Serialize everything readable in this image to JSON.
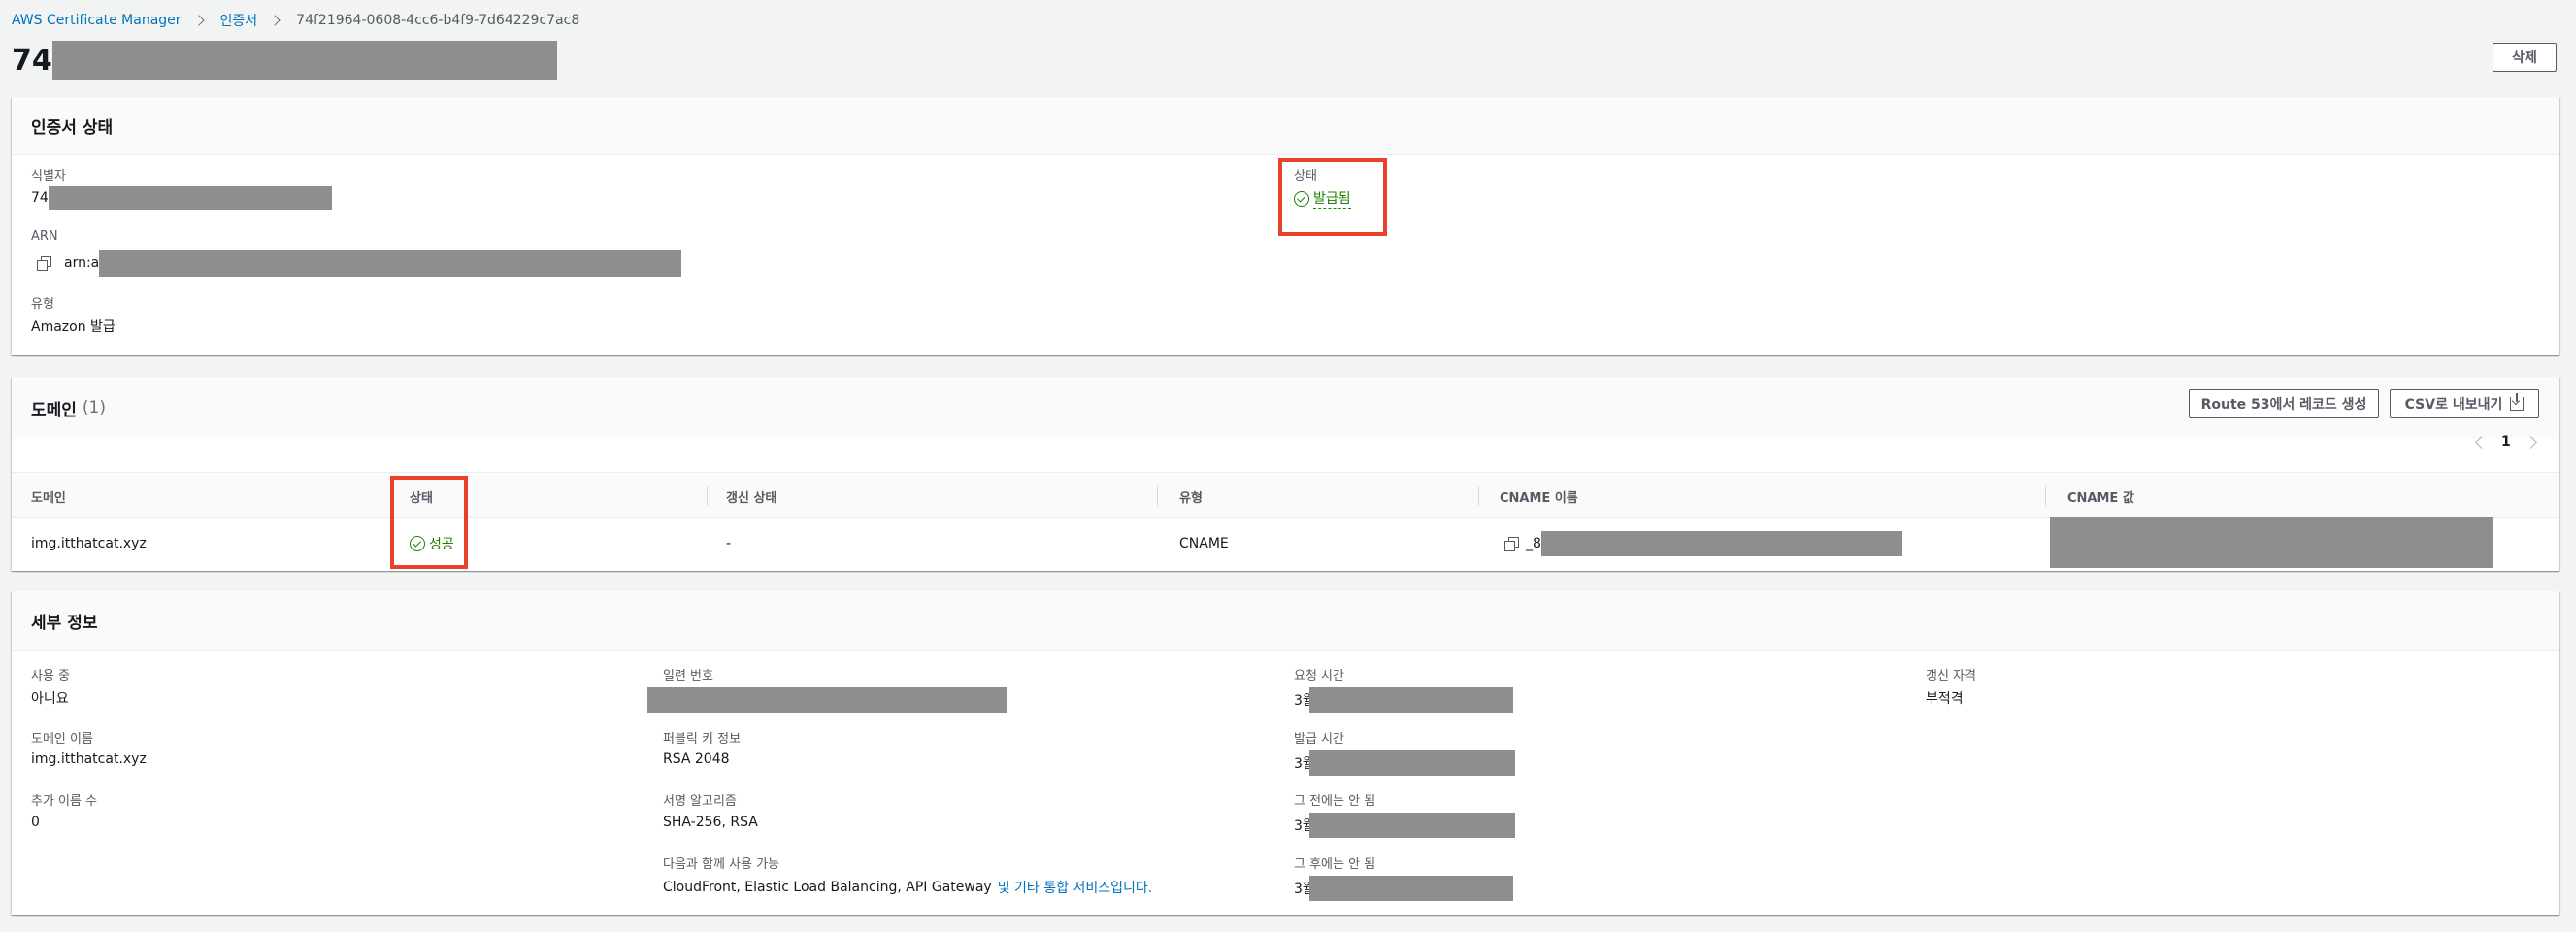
{
  "breadcrumb": {
    "items": [
      "AWS Certificate Manager",
      "인증서",
      "74f21964-0608-4cc6-b4f9-7d64229c7ac8"
    ]
  },
  "header": {
    "title_prefix": "74",
    "delete_label": "삭제"
  },
  "cert_status": {
    "title": "인증서 상태",
    "identifier_label": "식별자",
    "identifier_prefix": "74",
    "arn_label": "ARN",
    "arn_prefix": "arn:a",
    "type_label": "유형",
    "type_value": "Amazon 발급",
    "status_label": "상태",
    "status_value": "발급됨"
  },
  "domains": {
    "title": "도메인",
    "count": "(1)",
    "route53_label": "Route 53에서 레코드 생성",
    "csv_label": "CSV로 내보내기",
    "page": "1",
    "columns": [
      "도메인",
      "상태",
      "갱신 상태",
      "유형",
      "CNAME 이름",
      "CNAME 값"
    ],
    "rows": [
      {
        "domain": "img.itthatcat.xyz",
        "status": "성공",
        "renewal": "-",
        "type": "CNAME",
        "cname_prefix": "_8"
      }
    ]
  },
  "details": {
    "title": "세부 정보",
    "in_use_label": "사용 중",
    "in_use_value": "아니요",
    "domain_name_label": "도메인 이름",
    "domain_name_value": "img.itthatcat.xyz",
    "additional_names_label": "추가 이름 수",
    "additional_names_value": "0",
    "serial_label": "일련 번호",
    "public_key_label": "퍼블릭 키 정보",
    "public_key_value": "RSA 2048",
    "sig_label": "서명 알고리즘",
    "sig_value": "SHA-256, RSA",
    "usable_label": "다음과 함께 사용 가능",
    "usable_value": "CloudFront, Elastic Load Balancing, API Gateway",
    "usable_link": "및 기타 통합 서비스입니다.",
    "requested_label": "요청 시간",
    "issued_label": "발급 시간",
    "not_before_label": "그 전에는 안 됨",
    "not_after_label": "그 후에는 안 됨",
    "date_prefix": "3월",
    "renewal_label": "갱신 자격",
    "renewal_value": "부적격"
  },
  "colors": {
    "success": "#1d8102",
    "link": "#0073bb",
    "highlight": "#e8402b",
    "redaction": "#8e8e8e"
  }
}
